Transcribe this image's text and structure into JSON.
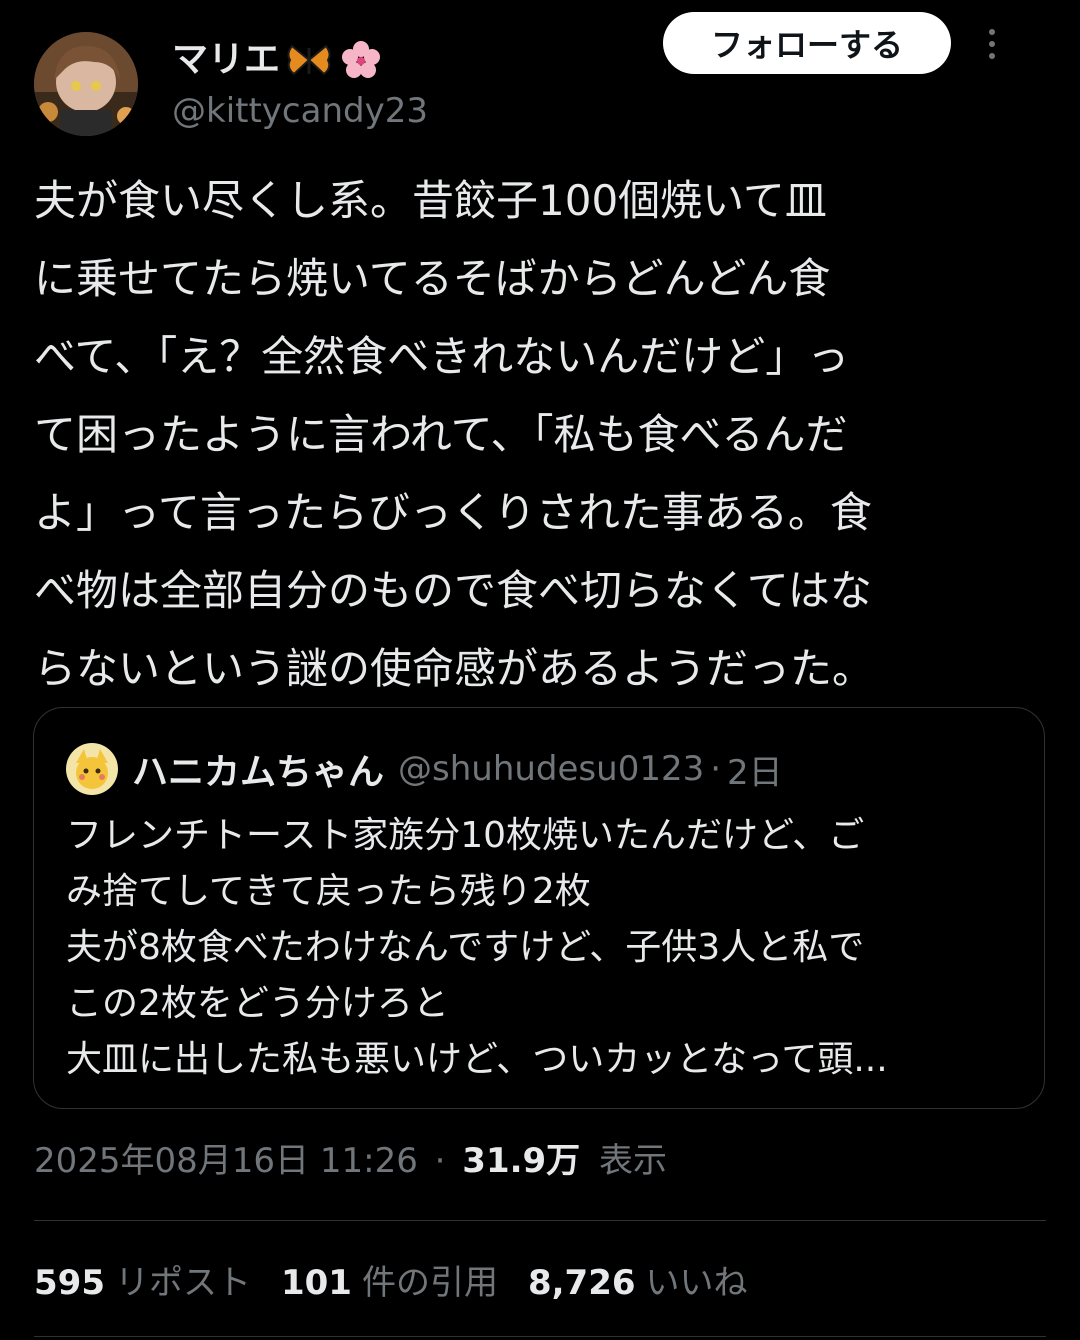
{
  "author": {
    "display_name": "マリエ",
    "name_emojis": [
      "butterfly-icon",
      "cherry-blossom-icon"
    ],
    "handle": "@kittycandy23",
    "avatar": "avatar-illustration"
  },
  "follow_button": {
    "label": "フォローする"
  },
  "more_icon": "more-vertical-icon",
  "tweet": {
    "lines": [
      "夫が食い尽くし系。昔餃子100個焼いて皿",
      "に乗せてたら焼いてるそばからどんどん食",
      "べて、「え？全然食べきれないんだけど」っ",
      "て困ったように言われて、「私も食べるんだ",
      "よ」って言ったらびっくりされた事ある。食",
      "べ物は全部自分のもので食べ切らなくてはな",
      "らないという謎の使命感があるようだった。"
    ]
  },
  "quote": {
    "display_name": "ハニカムちゃん",
    "handle": "@shuhudesu0123",
    "separator": "·",
    "time": "2日",
    "lines": [
      "フレンチトースト家族分10枚焼いたんだけど、ご",
      "み捨てしてきて戻ったら残り2枚",
      "夫が8枚食べたわけなんですけど、子供3人と私で",
      "この2枚をどう分けろと",
      "大皿に出した私も悪いけど、ついカッとなって頭..."
    ]
  },
  "meta": {
    "datetime": "2025年08月16日 11:26",
    "separator": "·",
    "views": "31.9万",
    "views_label": "表示"
  },
  "stats": {
    "reposts": "595",
    "reposts_label": "リポスト",
    "quotes": "101",
    "quotes_label": "件の引用",
    "likes": "8,726",
    "likes_label": "いいね"
  },
  "colors": {
    "background": "#000000",
    "text": "#e7e9ea",
    "secondary": "#71767b",
    "border": "#2f3336",
    "button_bg": "#ffffff"
  }
}
